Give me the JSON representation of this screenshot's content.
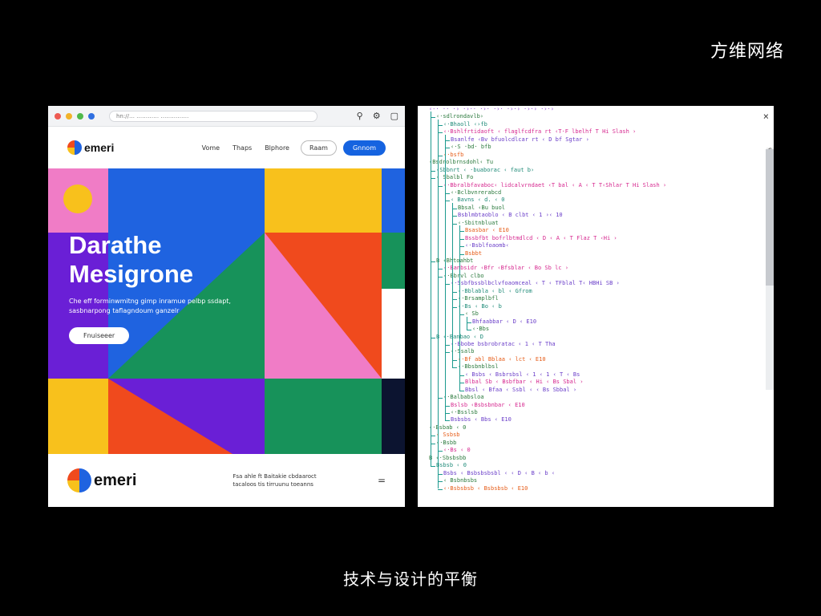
{
  "top_brand": "方维网络",
  "caption": "技术与设计的平衡",
  "browser": {
    "url": "hn://… ………… ……………",
    "logo_text": "emeri",
    "nav_links": [
      "Vome",
      "Thaps",
      "Blphore"
    ],
    "ghost_button": "Raam",
    "primary_button": "Gnnom",
    "hero_title_line1": "Darathe",
    "hero_title_line2": "Mesigrone",
    "hero_subtitle": "Che eff forminwmitng gimp inramue pelbp ssdapt, sasbnarpong taflagndoum ganzelr",
    "hero_cta": "Fnuiseeer",
    "footer_logo_text": "emeri",
    "footer_text": "Fsa ahle ft Baitakie cbdaaroct tacaloos tis tirruunu toeanns",
    "footer_menu_glyph": "="
  },
  "code_panel": {
    "close_glyph": "×",
    "side_glyph": "G",
    "lines": [
      {
        "indent": 0,
        "color": "#8e44d6",
        "text": "‹-· ·· ·› ·›·· ·›· ·›· ·›·› ·›·› ·›·›"
      },
      {
        "indent": 1,
        "color": "#2b7a3d",
        "text": "‹·sdlrondavlb›"
      },
      {
        "indent": 2,
        "color": "#1e8a78",
        "text": "‹·Bhaoll ‹›fb"
      },
      {
        "indent": 2,
        "color": "#d6288f",
        "text": "‹·Bshlfrtidaoft ‹ flaglfcdfra rt ‹T·F lbelhf T Hi Slash ›"
      },
      {
        "indent": 3,
        "color": "#6b3fc9",
        "text": "Bsanlfe ‹Bv bfuolcdlcar rt ‹ D bf Sgtar ›"
      },
      {
        "indent": 3,
        "color": "#2b7a3d",
        "text": "‹·S ·bd· bfb"
      },
      {
        "indent": 2,
        "color": "#e65c18",
        "text": "‹·bsfb"
      },
      {
        "indent": 0,
        "color": "#2b7a3d",
        "text": "‹Bsdrolbrnsdohl‹ Tu"
      },
      {
        "indent": 1,
        "color": "#1e8a78",
        "text": "‹Sbbnrt ‹ ·buaborac ‹ faut b›"
      },
      {
        "indent": 1,
        "color": "#2b7a3d",
        "text": "‹ Sbalbl Fo"
      },
      {
        "indent": 2,
        "color": "#d6288f",
        "text": "‹·Bbralbfavaboc‹ lidcalvrndaet ‹T bal ‹ A ‹ T T‹Shlar T Hi Slash ›"
      },
      {
        "indent": 3,
        "color": "#2b7a3d",
        "text": "‹·Bclbvnrerabcd"
      },
      {
        "indent": 3,
        "color": "#1e8a78",
        "text": "‹ Bavns ‹ d. ‹ 0"
      },
      {
        "indent": 4,
        "color": "#2b7a3d",
        "text": "Bbsal ‹Bu buol"
      },
      {
        "indent": 4,
        "color": "#6b3fc9",
        "text": "Bsblmbtaoblo ‹ B clbt ‹ 1 ›‹ 10"
      },
      {
        "indent": 4,
        "color": "#2b7a3d",
        "text": "‹·Sbitnbluat"
      },
      {
        "indent": 5,
        "color": "#e65c18",
        "text": "Bsasbar ‹ E10"
      },
      {
        "indent": 5,
        "color": "#d6288f",
        "text": "Bssbfbt bofrlbtmdlcd ‹ D ‹ A ‹ T Flaz T ‹Hi ›"
      },
      {
        "indent": 5,
        "color": "#6b3fc9",
        "text": "‹·Bsblfoaomb‹"
      },
      {
        "indent": 5,
        "color": "#e65c18",
        "text": "Bsbbt"
      },
      {
        "indent": 1,
        "color": "#2b7a3d",
        "text": "B ‹Bhtoahbt"
      },
      {
        "indent": 2,
        "color": "#d6288f",
        "text": "‹·Banbsidr ‹Bfr ‹Bfsblar ‹ Bo Sb lc ›"
      },
      {
        "indent": 2,
        "color": "#2b7a3d",
        "text": "‹·Bbrvl clbo"
      },
      {
        "indent": 3,
        "color": "#6b3fc9",
        "text": "‹·Ssbfbssblbclvfoaomceal ‹ T ‹ TFblal T‹ HBHi SB ›"
      },
      {
        "indent": 4,
        "color": "#1e8a78",
        "text": "‹·Bblabla ‹ bl ‹ Gfrom"
      },
      {
        "indent": 4,
        "color": "#2b7a3d",
        "text": "‹·Brsamplbfl"
      },
      {
        "indent": 4,
        "color": "#1e8a78",
        "text": "‹·Bs ‹ Bo ‹ b"
      },
      {
        "indent": 5,
        "color": "#2b7a3d",
        "text": "‹ Sb"
      },
      {
        "indent": 6,
        "color": "#6b3fc9",
        "text": "Bhfaabbar ‹ D ‹ E10"
      },
      {
        "indent": 6,
        "color": "#2b7a3d",
        "text": "‹·Bbs"
      },
      {
        "indent": 1,
        "color": "#1e8a78",
        "text": "B ‹·Banbao ‹ D"
      },
      {
        "indent": 3,
        "color": "#6b3fc9",
        "text": "‹·Bbobe bsbrobratac ‹ 1 ‹ T Tha"
      },
      {
        "indent": 3,
        "color": "#2b7a3d",
        "text": "‹·Ssalb"
      },
      {
        "indent": 4,
        "color": "#e65c18",
        "text": "‹·Bf  abl Bblaa ‹ lct ‹ E10"
      },
      {
        "indent": 4,
        "color": "#2b7a3d",
        "text": "‹·Bbsbnblbsl"
      },
      {
        "indent": 5,
        "color": "#6b3fc9",
        "text": "‹ Bsbs ‹ Bsbrsbsl ‹ 1 ‹ 1 ‹ T ‹ Bs"
      },
      {
        "indent": 5,
        "color": "#d6288f",
        "text": "Blbal Sb ‹ Bsbfbar ‹ Hi ‹ Bs Sbal ›"
      },
      {
        "indent": 5,
        "color": "#6b3fc9",
        "text": "Bbsl ‹ Bfaa ‹ Ssbl ‹ ‹ Bs Sbbal ›"
      },
      {
        "indent": 2,
        "color": "#2b7a3d",
        "text": "‹·Balbabsloa"
      },
      {
        "indent": 3,
        "color": "#d6288f",
        "text": "Bslsb ‹Bsbsbnbar ‹ E10"
      },
      {
        "indent": 3,
        "color": "#2b7a3d",
        "text": "‹·Bsslsb"
      },
      {
        "indent": 3,
        "color": "#6b3fc9",
        "text": "Bsbsbs ‹ Bbs ‹ E10"
      },
      {
        "indent": 0,
        "color": "#2b7a3d",
        "text": "‹·Bsbab ‹ 0"
      },
      {
        "indent": 1,
        "color": "#e65c18",
        "text": "‹ Ssbsb"
      },
      {
        "indent": 1,
        "color": "#2b7a3d",
        "text": "‹·Bsbb"
      },
      {
        "indent": 2,
        "color": "#d6288f",
        "text": "‹·Bs ‹ 0"
      },
      {
        "indent": 0,
        "color": "#2b7a3d",
        "text": "B ‹·Sbsbsbb"
      },
      {
        "indent": 1,
        "color": "#1e8a78",
        "text": "Bsbsb ‹ 0"
      },
      {
        "indent": 2,
        "color": "#6b3fc9",
        "text": "Bsbs ‹ Bsbsbsbsbl ‹ ‹ D ‹ B ‹ b ‹"
      },
      {
        "indent": 2,
        "color": "#2b7a3d",
        "text": "‹ Bsbnbsbs"
      },
      {
        "indent": 2,
        "color": "#e65c18",
        "text": "‹·Bsbsbsb ‹ Bsbsbsb ‹ E10"
      }
    ]
  },
  "colors": {
    "yellow": "#f8c11c",
    "pink": "#f07cc6",
    "purple": "#6a1fd6",
    "blue": "#1f63e0",
    "green": "#17925a",
    "red": "#f04a1d",
    "navy": "#0c1430",
    "primary_button": "#1563e0"
  }
}
